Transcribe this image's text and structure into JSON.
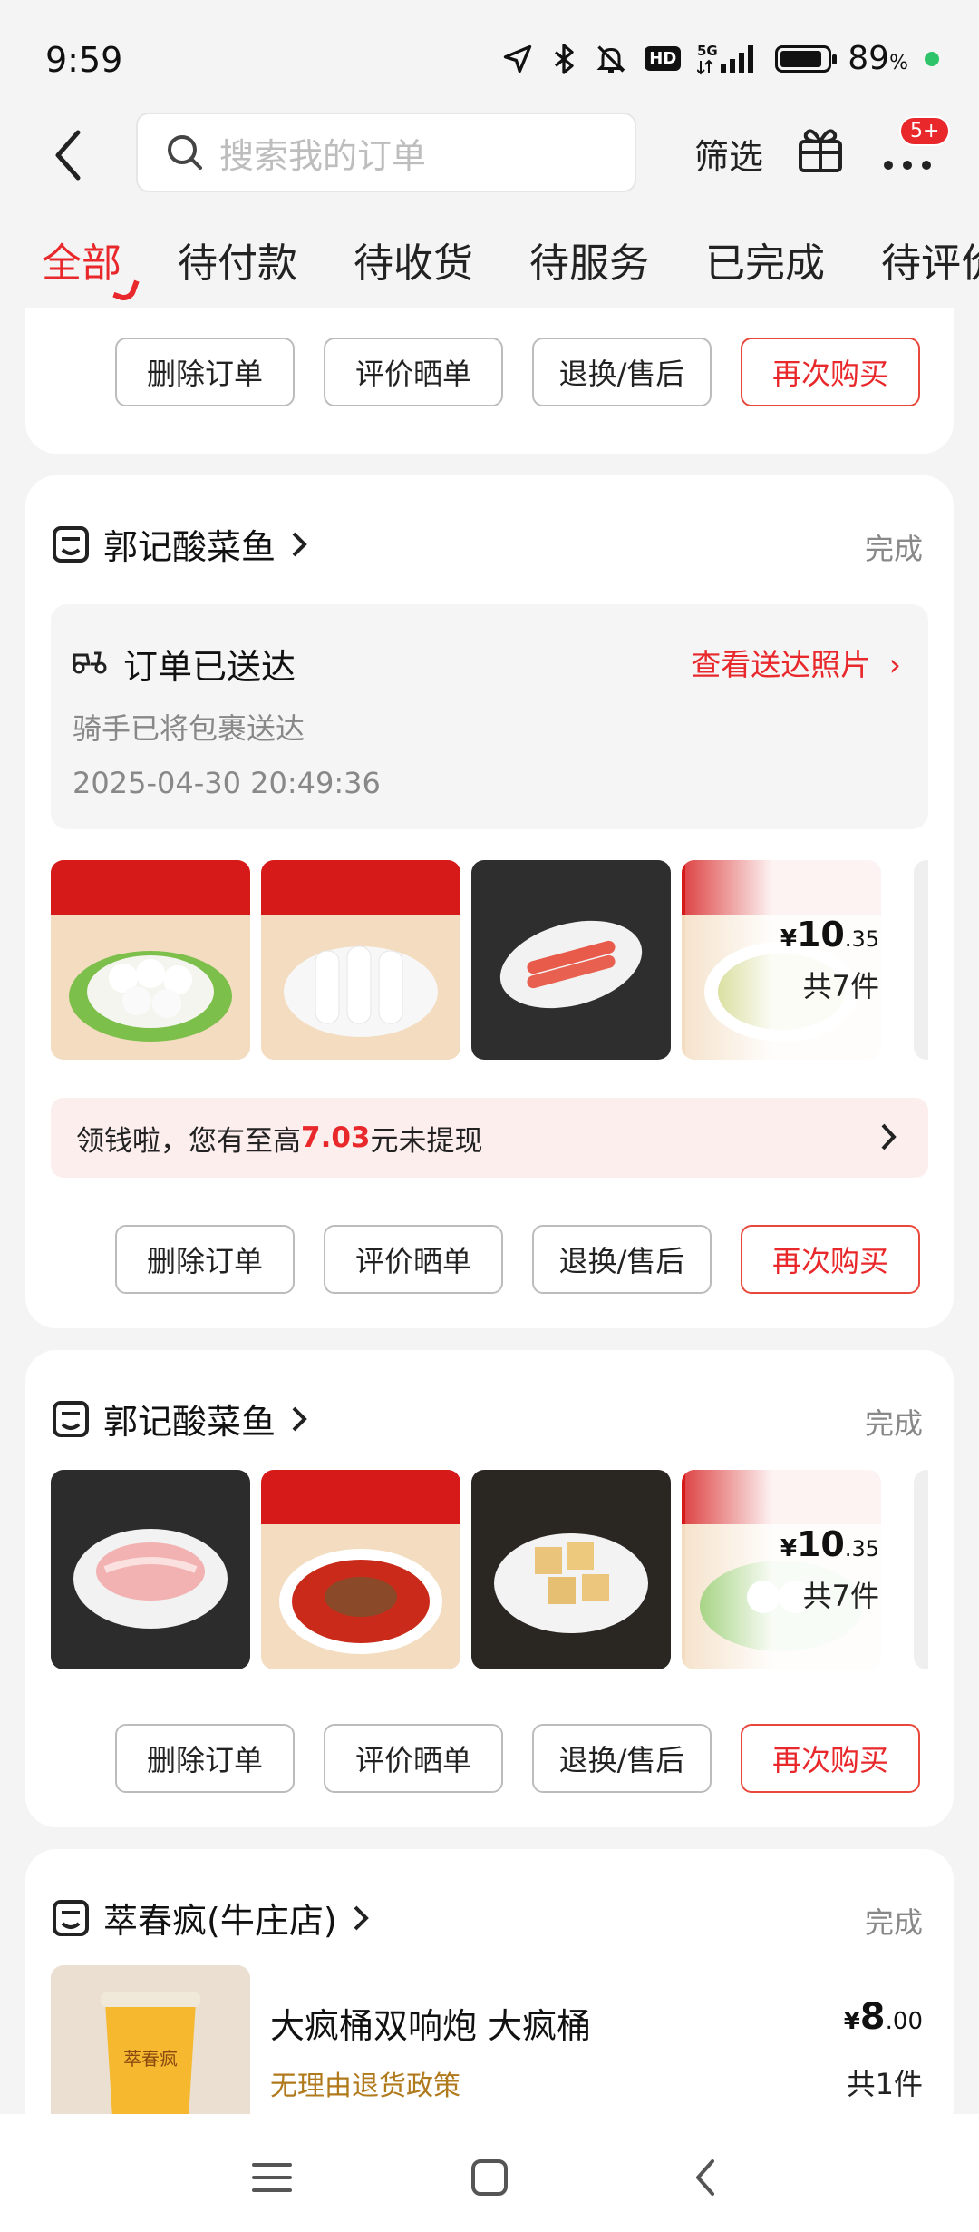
{
  "status_bar": {
    "time": "9:59",
    "hd": "HD",
    "net": "5G",
    "battery_pct": "89",
    "battery_unit": "%",
    "battery_level": 0.89
  },
  "header": {
    "search_placeholder": "搜索我的订单",
    "filter_label": "筛选",
    "badge": "5+"
  },
  "tabs": [
    "全部",
    "待付款",
    "待收货",
    "待服务",
    "已完成",
    "待评价"
  ],
  "buttons": {
    "delete": "删除订单",
    "review": "评价晒单",
    "return": "退换/售后",
    "rebuy": "再次购买"
  },
  "orders": [
    {
      "shop": "郭记酸菜鱼",
      "status": "完成",
      "delivery": {
        "title": "订单已送达",
        "link": "查看送达照片",
        "sub": "骑手已将包裹送达",
        "time": "2025-04-30 20:49:36"
      },
      "price_int": "10",
      "price_dec": ".35",
      "currency": "¥",
      "count": "共7件",
      "promo": {
        "prefix": "领钱啦，您有至高",
        "amount": "7.03",
        "suffix": "元未提现"
      }
    },
    {
      "shop": "郭记酸菜鱼",
      "status": "完成",
      "price_int": "10",
      "price_dec": ".35",
      "currency": "¥",
      "count": "共7件"
    },
    {
      "shop": "萃春疯(牛庄店)",
      "status": "完成",
      "product": "大疯桶双响炮 大疯桶",
      "policy": "无理由退货政策",
      "price_int": "8",
      "price_dec": ".00",
      "currency": "¥",
      "count": "共1件",
      "cup_brand": "萃春疯"
    }
  ],
  "colors": {
    "accent": "#e8282b",
    "bg": "#f4f4f4"
  }
}
